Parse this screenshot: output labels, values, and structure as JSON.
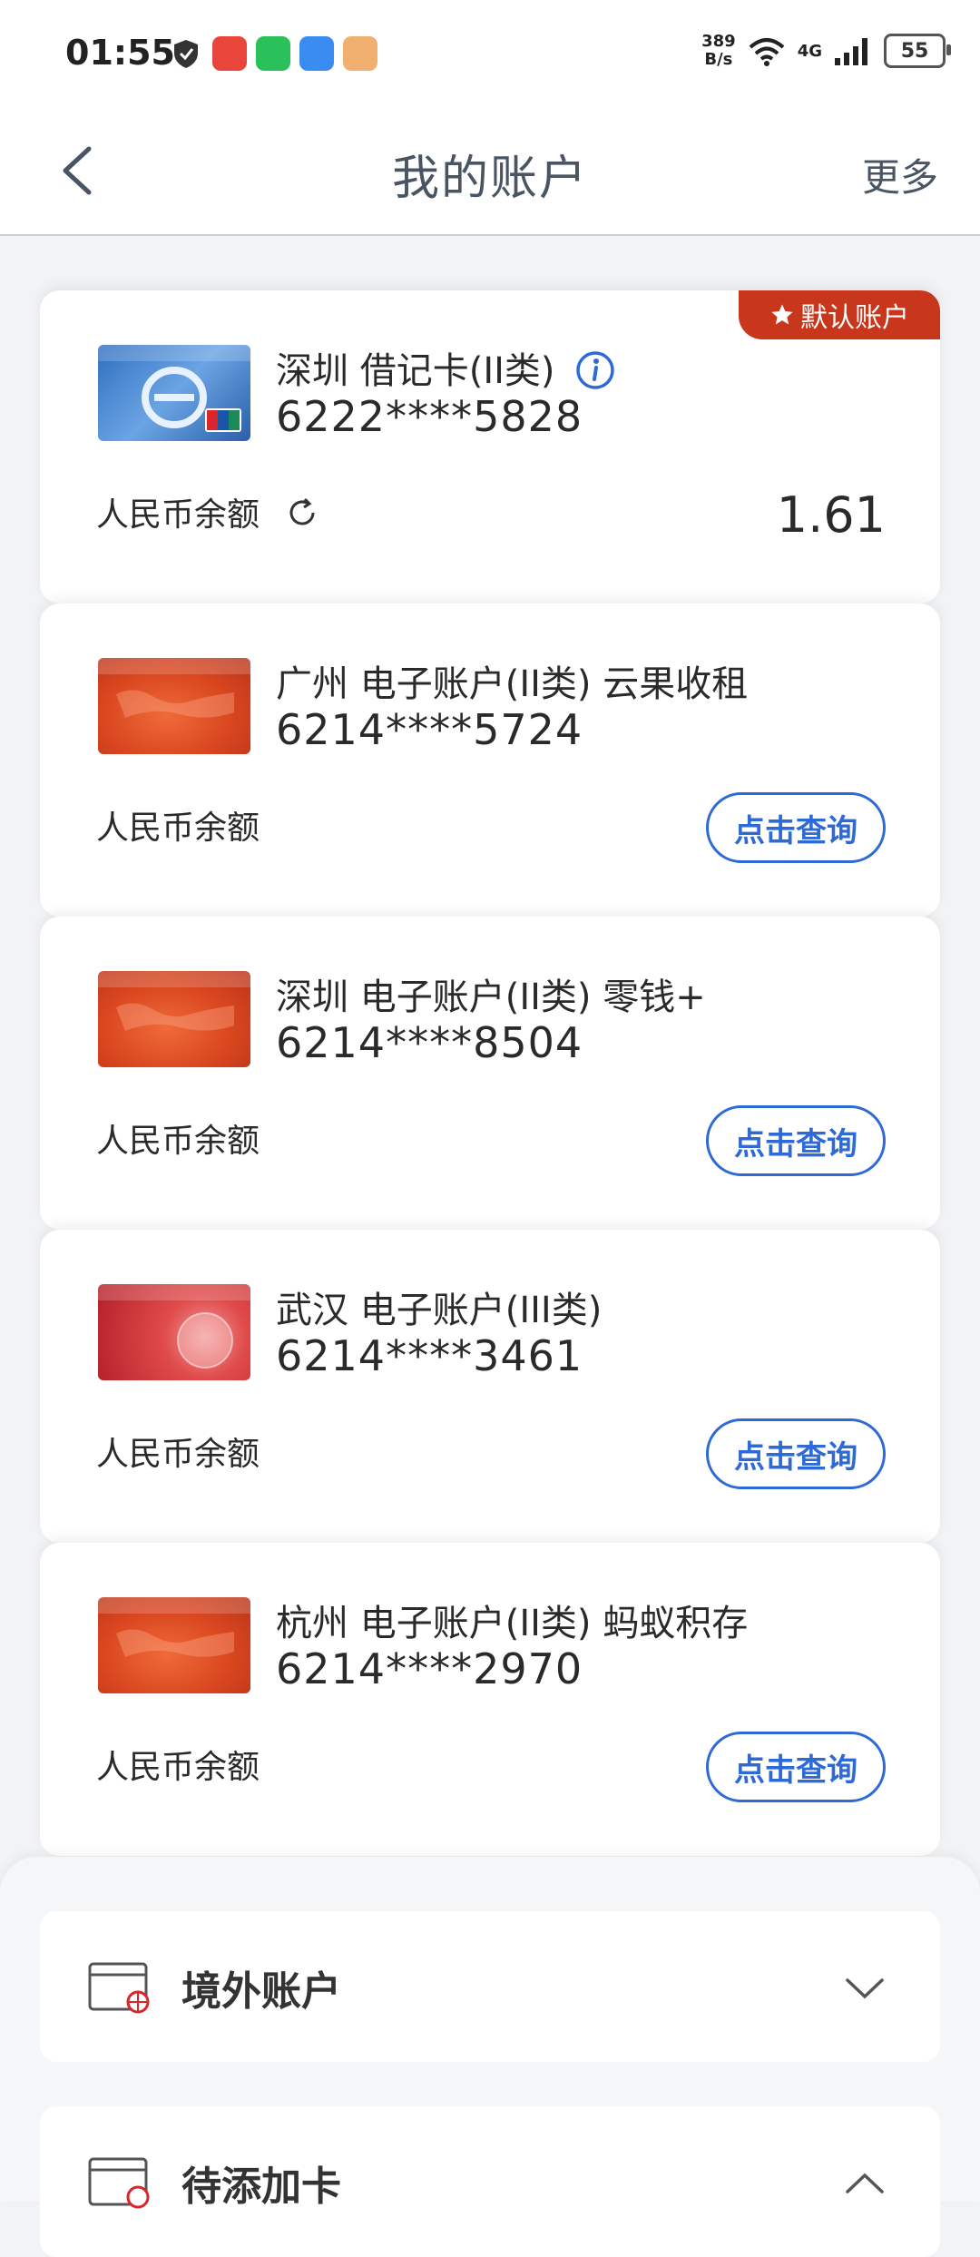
{
  "status_bar": {
    "time": "01:55",
    "net_speed_value": "389",
    "net_speed_unit": "B/s",
    "network": "4G",
    "battery": "55"
  },
  "nav": {
    "title": "我的账户",
    "more": "更多"
  },
  "balance_label": "人民币余额",
  "query_label": "点击查询",
  "default_tag": "默认账户",
  "accounts": [
    {
      "title": "深圳 借记卡(II类)",
      "number": "6222****5828",
      "balance": "1.61",
      "thumb": "blue"
    },
    {
      "title": "广州 电子账户(II类) 云果收租",
      "number": "6214****5724",
      "thumb": "orange"
    },
    {
      "title": "深圳 电子账户(II类) 零钱+",
      "number": "6214****8504",
      "thumb": "orange"
    },
    {
      "title": "武汉 电子账户(III类)",
      "number": "6214****3461",
      "thumb": "red"
    },
    {
      "title": "杭州 电子账户(II类) 蚂蚁积存",
      "number": "6214****2970",
      "thumb": "orange"
    }
  ],
  "sections": {
    "overseas": "境外账户",
    "pending": "待添加卡"
  },
  "colors": {
    "accent_blue": "#2d6ad6",
    "default_tag_red": "#c8371b",
    "background": "#f2f3f5"
  }
}
